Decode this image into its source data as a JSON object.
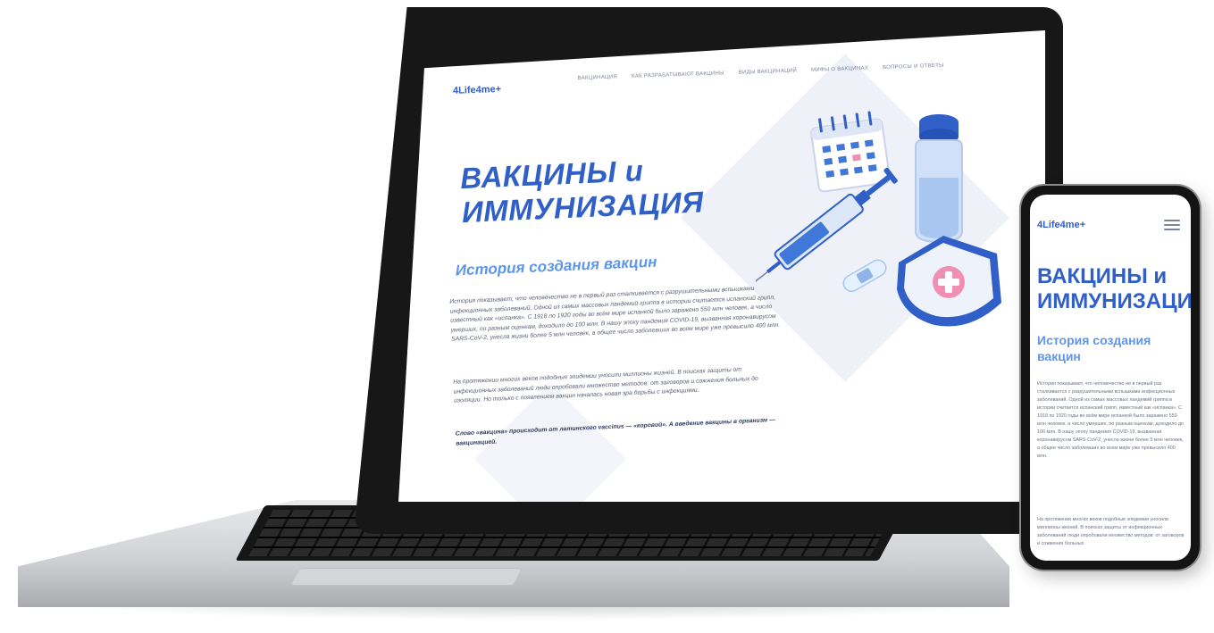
{
  "site": {
    "logo": "4Life4me+",
    "nav": [
      "ВАКЦИНАЦИЯ",
      "КАК РАЗРАБАТЫВАЮТ ВАКЦИНЫ",
      "ВИДЫ ВАКЦИНАЦИЙ",
      "МИФЫ О ВАКЦИНАХ",
      "ВОПРОСЫ И ОТВЕТЫ"
    ],
    "hero_title_line1": "ВАКЦИНЫ и",
    "hero_title_line2": "ИММУНИЗАЦИЯ",
    "section_title": "История создания вакцин",
    "paragraph1": "История показывает, что человечество не в первый раз сталкивается с разрушительными вспышками инфекционных заболеваний. Одной из самых массовых пандемий гриппа в истории считается испанский грипп, известный как «испанка». С 1918 по 1920 годы во всём мире испанкой было заражено 550 млн человек, а число умерших, по разным оценкам, доходило до 100 млн. В нашу эпоху пандемия COVID-19, вызванная коронавирусом SARS-CoV-2, унесла жизни более 5 млн человек, а общее число заболевших во всем мире уже превысило 400 млн.",
    "paragraph2": "На протяжении многих веков подобные эпидемии уносили миллионы жизней. В поисках защиты от инфекционных заболеваний люди опробовали множество методов: от заговоров и сожжения больных до изоляции. Но только с появлением вакцин началась новая эра борьбы с инфекциями.",
    "paragraph3": "Слово «вакцина» происходит от латинского vaccinus — «коровий». А введение вакцины в организм — вакцинацией.",
    "phone_paragraph2": "На протяжении многих веков подобные эпидемии уносили миллионы жизней. В поисках защиты от инфекционных заболеваний люди опробовали множество методов: от заговоров и сожжения больных"
  },
  "colors": {
    "brand_blue": "#2f5fc7",
    "light_blue": "#5d96ea",
    "accent_pink": "#f08fb4"
  }
}
